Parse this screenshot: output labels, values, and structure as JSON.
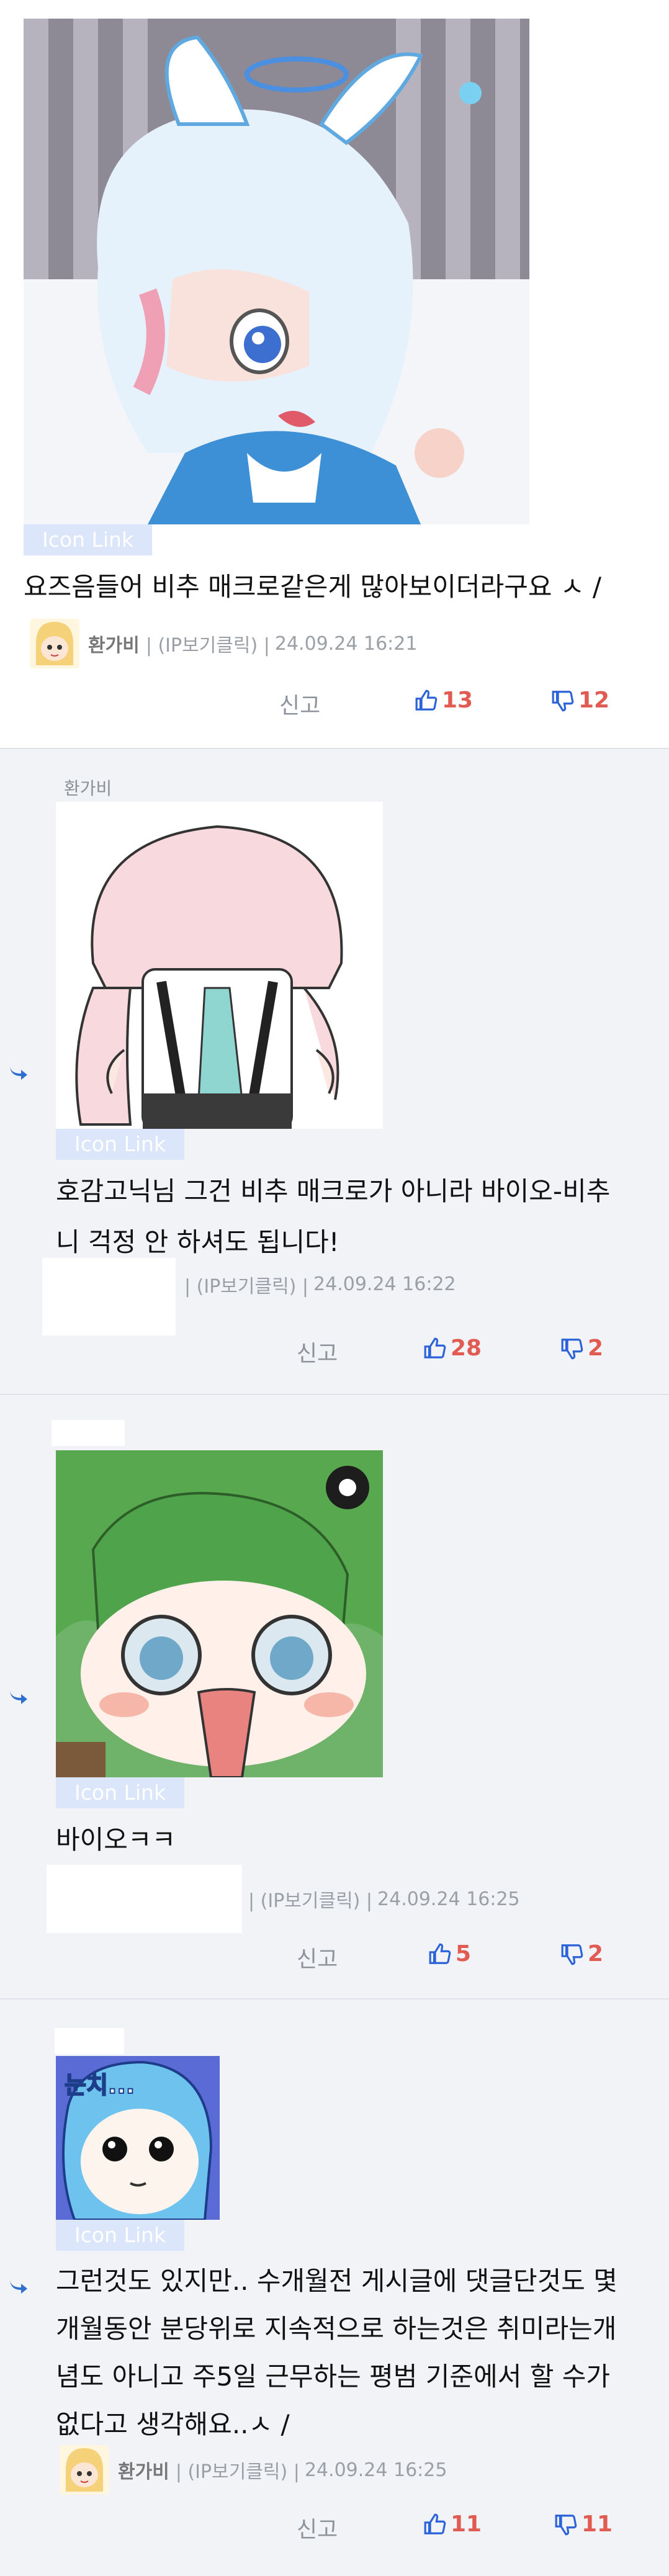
{
  "icon_link_label": "Icon Link",
  "report_label": "신고",
  "comments": [
    {
      "text_lines": [
        "요즈음들어 비추 매크로같은게 많아보이더라구요 ㅅ /"
      ],
      "nickname": "환가비",
      "ip_label": "| (IP보기클릭) |",
      "timestamp": "24.09.24 16:21",
      "upvotes": "13",
      "downvotes": "12"
    },
    {
      "parent_nick": "환가비",
      "text_lines": [
        "호감고닉님 그건 비추 매크로가 아니라 바이오-비추",
        "니 걱정 안 하셔도 됩니다!"
      ],
      "nickname": "",
      "ip_label": "| (IP보기클릭) |",
      "timestamp": "24.09.24 16:22",
      "upvotes": "28",
      "downvotes": "2"
    },
    {
      "text_lines": [
        "바이오ㅋㅋ"
      ],
      "nickname": "",
      "ip_label": "| (IP보기클릭) |",
      "timestamp": "24.09.24 16:25",
      "upvotes": "5",
      "downvotes": "2"
    },
    {
      "image_caption": "눈치...",
      "text_lines": [
        "그런것도 있지만.. 수개월전 게시글에 댓글단것도 몇",
        "개월동안 분당위로 지속적으로 하는것은 취미라는개",
        "념도 아니고 주5일 근무하는 평범 기준에서 할 수가",
        "없다고 생각해요..ㅅ /"
      ],
      "nickname": "환가비",
      "ip_label": "| (IP보기클릭) |",
      "timestamp": "24.09.24 16:25",
      "upvotes": "11",
      "downvotes": "11"
    }
  ]
}
